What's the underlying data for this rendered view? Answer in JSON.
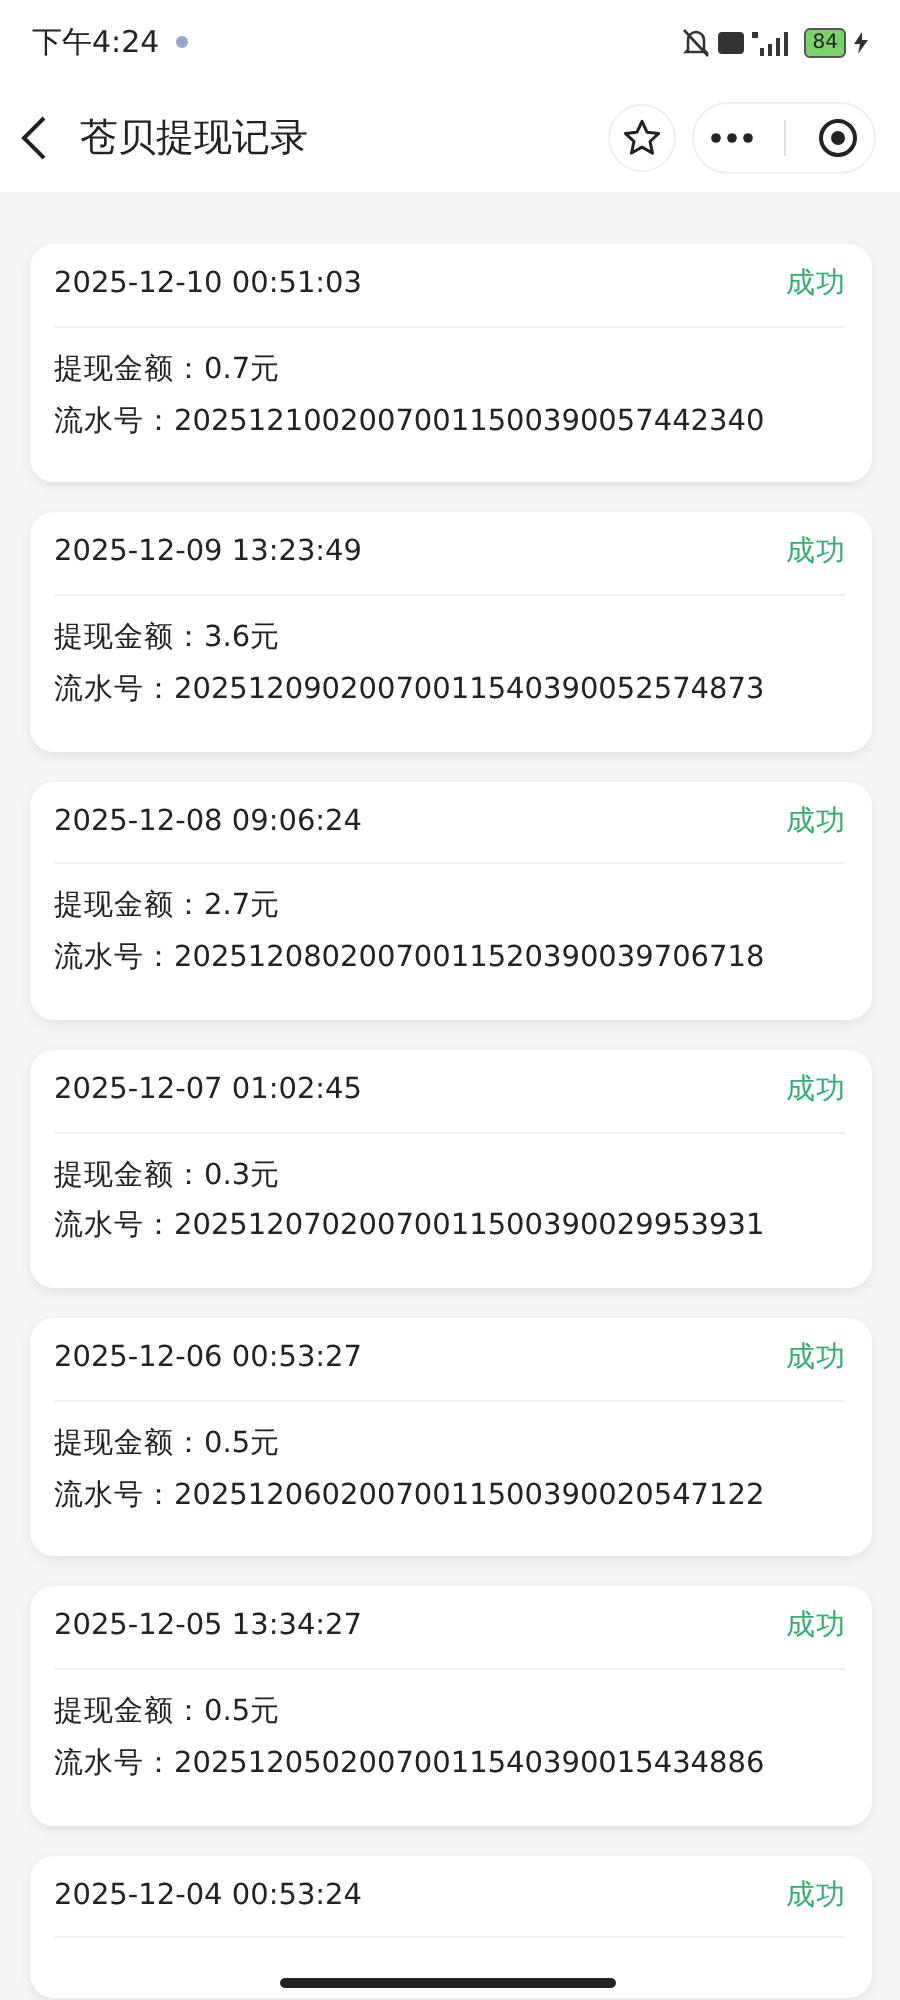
{
  "status_bar": {
    "time": "下午4:24",
    "battery": "84"
  },
  "header": {
    "title": "苍贝提现记录"
  },
  "records": [
    {
      "datetime": "2025-12-10 00:51:03",
      "status": "成功",
      "kind": "success",
      "amount_label": "提现金额：",
      "amount": "0.7元",
      "serial_label": "流水号：",
      "serial": "20251210020070011500390057442340"
    },
    {
      "datetime": "2025-12-09 13:23:49",
      "status": "成功",
      "kind": "success",
      "amount_label": "提现金额：",
      "amount": "3.6元",
      "serial_label": "流水号：",
      "serial": "20251209020070011540390052574873"
    },
    {
      "datetime": "2025-12-08 09:06:24",
      "status": "成功",
      "kind": "success",
      "amount_label": "提现金额：",
      "amount": "2.7元",
      "serial_label": "流水号：",
      "serial": "20251208020070011520390039706718"
    },
    {
      "datetime": "2025-12-07 01:02:45",
      "status": "成功",
      "kind": "success",
      "amount_label": "提现金额：",
      "amount": "0.3元",
      "serial_label": "流水号：",
      "serial": "20251207020070011500390029953931"
    },
    {
      "datetime": "2025-12-06 00:53:27",
      "status": "成功",
      "kind": "success",
      "amount_label": "提现金额：",
      "amount": "0.5元",
      "serial_label": "流水号：",
      "serial": "20251206020070011500390020547122"
    },
    {
      "datetime": "2025-12-05 13:34:27",
      "status": "成功",
      "kind": "success",
      "amount_label": "提现金额：",
      "amount": "0.5元",
      "serial_label": "流水号：",
      "serial": "20251205020070011540390015434886"
    },
    {
      "datetime": "2025-12-04 00:53:24",
      "status": "成功",
      "kind": "success"
    }
  ]
}
